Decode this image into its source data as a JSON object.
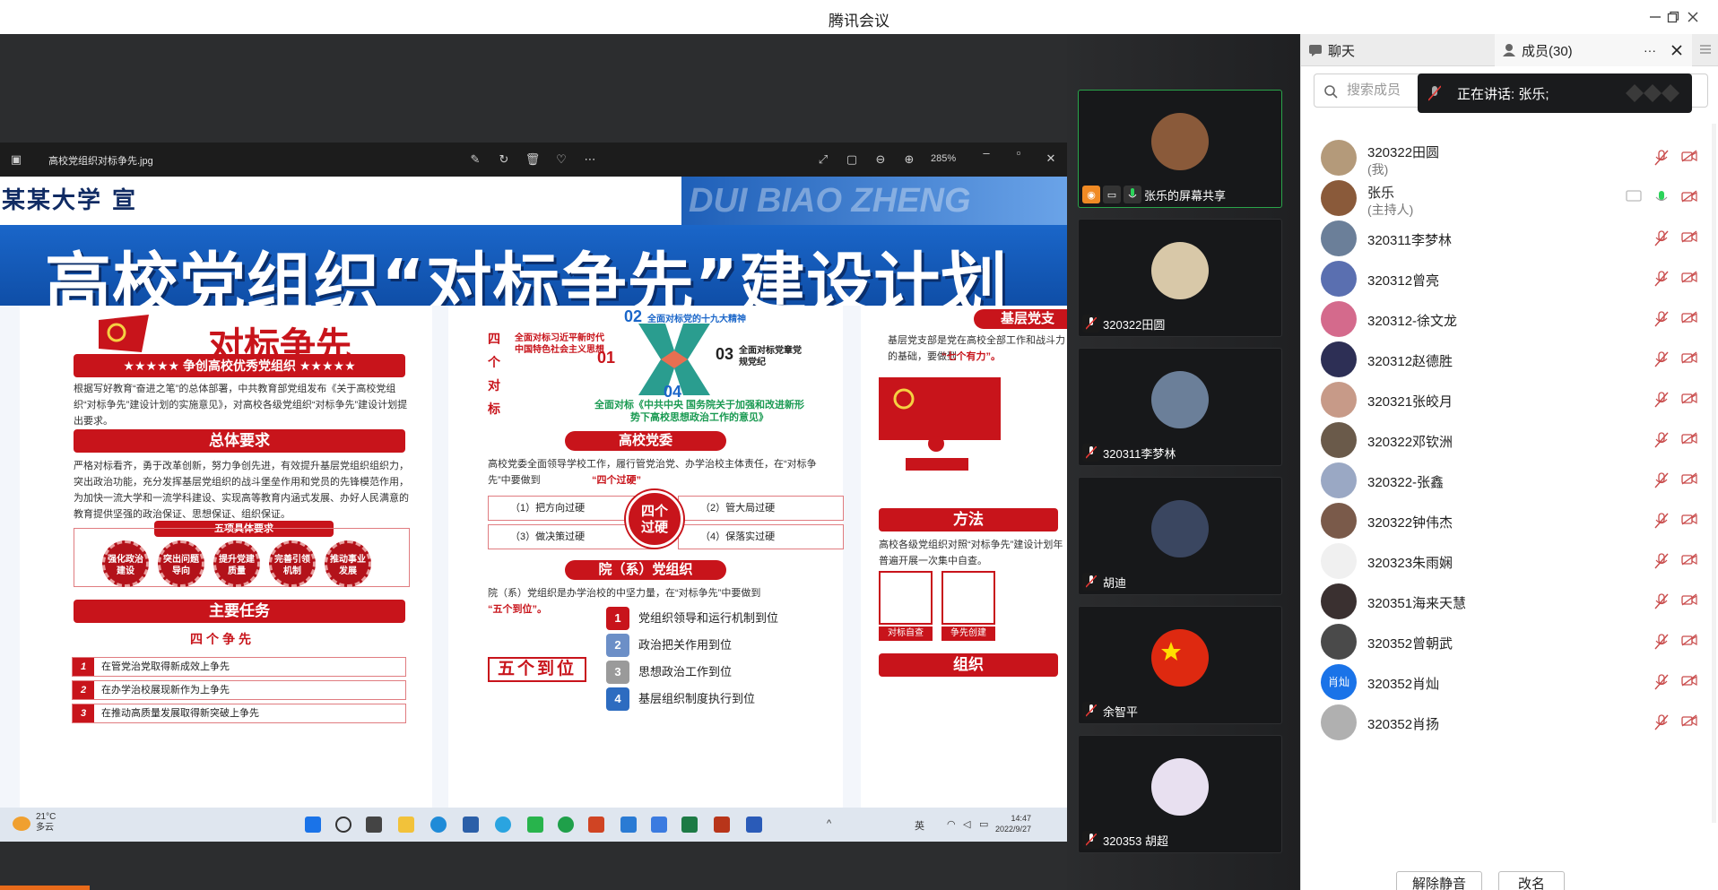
{
  "app": {
    "title": "腾讯会议"
  },
  "viewer": {
    "filename": "高校党组织对标争先.jpg",
    "zoom": "285%"
  },
  "poster": {
    "university": "某某大学  宣",
    "banner_en": "DUI BIAO ZHENG",
    "banner": "高校党组织“对标争先”建设计划",
    "col1_title": "对标争先",
    "col1_sub": "★★★★★ 争创高校优秀党组织 ★★★★★",
    "col1_intro": "根据写好教育“奋进之笔”的总体部署，中共教育部党组发布《关于高校党组织“对标争先”建设计划的实施意见》，对高校各级党组织“对标争先”建设计划提出要求。",
    "general_req": "总体要求",
    "general_text": "严格对标看齐，勇于改革创新，努力争创先进，有效提升基层党组织组织力，突出政治功能，充分发挥基层党组织的战斗堡垒作用和党员的先锋模范作用，为加快一流大学和一流学科建设、实现高等教育内涵式发展、办好人民满意的教育提供坚强的政治保证、思想保证、组织保证。",
    "five_req": "五项具体要求",
    "badges": [
      "强化政治建设",
      "突出问题导向",
      "提升党建质量",
      "完善引领机制",
      "推动事业发展"
    ],
    "main_tasks": "主要任务",
    "four_compete": "四个争先",
    "tasks": [
      {
        "n": "1",
        "text": "在管党治党取得新成效上争先"
      },
      {
        "n": "2",
        "text": "在办学治校展现新作为上争先"
      },
      {
        "n": "3",
        "text": "在推动高质量发展取得新突破上争先"
      }
    ],
    "four_duibiao": "四个对标",
    "x_01": "01",
    "x_02": "02",
    "x_03": "03",
    "x_04": "04",
    "x_01_text": "全面对标习近平新时代中国特色社会主义思想",
    "x_02_text": "全面对标党的十九大精神",
    "x_03_text": "全面对标党章党规党纪",
    "x_04_text": "全面对标《中共中央 国务院关于加强和改进新形势下高校思想政治工作的意见》",
    "party_committee": "高校党委",
    "committee_text": "高校党委全面领导学校工作，履行管党治党、办学治校主体责任，在“对标争先”中要做到",
    "four_hard": "“四个过硬”",
    "rules": [
      "（1）把方向过硬",
      "（2）管大局过硬",
      "（3）做决策过硬",
      "（4）保落实过硬"
    ],
    "hard_center": "四个过硬",
    "dept_org": "院（系）党组织",
    "dept_text": "院（系）党组织是办学治校的中坚力量，在“对标争先”中要做到",
    "five_in_place": "“五个到位”。",
    "five_big": "五个到位",
    "in_place": [
      {
        "n": "1",
        "text": "党组织领导和运行机制到位"
      },
      {
        "n": "2",
        "text": "政治把关作用到位"
      },
      {
        "n": "3",
        "text": "思想政治工作到位"
      },
      {
        "n": "4",
        "text": "基层组织制度执行到位"
      }
    ],
    "grassroots": "基层党支",
    "grassroots_text": "基层党支部是党在高校全部工作和战斗力的基础，要做到",
    "seven": "“七个有力”。",
    "method": "方法",
    "method_text": "高校各级党组织对照“对标争先”建设计划年普遍开展一次集中自查。",
    "icons_text": [
      "对标自查",
      "争先创建"
    ],
    "org": "组织"
  },
  "taskbar": {
    "temp": "21°C",
    "weather": "多云",
    "time": "14:47",
    "date": "2022/9/27",
    "ime": "英"
  },
  "gallery": [
    {
      "name": "张乐的屏幕共享",
      "active": true,
      "color": "#8a5a3a"
    },
    {
      "name": "320322田圆",
      "active": false,
      "color": "#d8c8a8"
    },
    {
      "name": "320311李梦林",
      "active": false,
      "color": "#6b7f99"
    },
    {
      "name": "胡迪",
      "active": false,
      "color": "#3a4660"
    },
    {
      "name": "余智平",
      "active": false,
      "color": "#de2910"
    },
    {
      "name": "320353 胡超",
      "active": false,
      "color": "#e8e0f0"
    }
  ],
  "panel": {
    "tab_chat": "聊天",
    "tab_members": "成员(30)",
    "more": "···",
    "search_placeholder": "搜索成员",
    "speaking": "正在讲话: 张乐;",
    "unmute": "解除静音",
    "rename": "改名",
    "members": [
      {
        "name": "320322田圆",
        "sub": "(我)",
        "color": "#b49a7a"
      },
      {
        "name": "张乐",
        "sub": "(主持人)",
        "color": "#8a5a3a"
      },
      {
        "name": "320311李梦林",
        "sub": "",
        "color": "#6b7f99"
      },
      {
        "name": "320312曾亮",
        "sub": "",
        "color": "#5a6fb0"
      },
      {
        "name": "320312-徐文龙",
        "sub": "",
        "color": "#d46a8c"
      },
      {
        "name": "320312赵德胜",
        "sub": "",
        "color": "#2d2f55"
      },
      {
        "name": "320321张皎月",
        "sub": "",
        "color": "#c79a88"
      },
      {
        "name": "320322邓钦洲",
        "sub": "",
        "color": "#6a5a4a"
      },
      {
        "name": "320322-张鑫",
        "sub": "",
        "color": "#9aa8c4"
      },
      {
        "name": "320322钟伟杰",
        "sub": "",
        "color": "#7a5a4a"
      },
      {
        "name": "320323朱雨娴",
        "sub": "",
        "color": "#f0f0f0"
      },
      {
        "name": "320351海来天慧",
        "sub": "",
        "color": "#3a3030"
      },
      {
        "name": "320352曾朝武",
        "sub": "",
        "color": "#4a4a4a"
      },
      {
        "name": "320352肖灿",
        "sub": "",
        "color": "#1a73e8",
        "initials": "肖灿"
      },
      {
        "name": "320352肖扬",
        "sub": "",
        "color": "#b0b0b0"
      }
    ]
  }
}
